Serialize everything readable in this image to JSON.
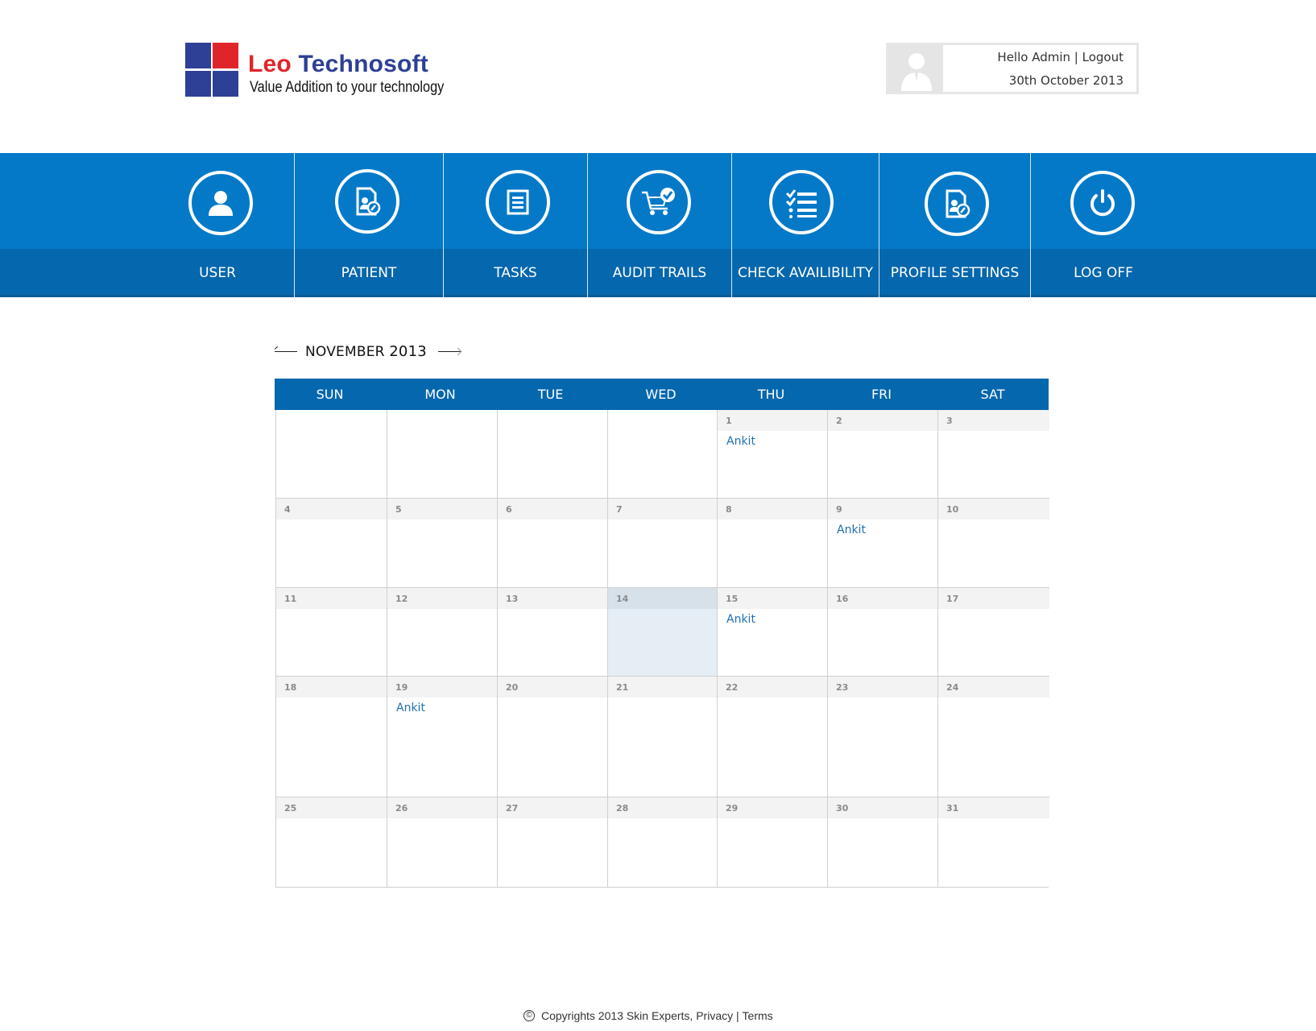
{
  "header": {
    "brand": {
      "name_part1": "Leo",
      "name_part2": "Technosoft",
      "tagline": "Value Addition to your technology"
    },
    "user": {
      "greeting": "Hello Admin",
      "separator": "|",
      "logout_label": "Logout",
      "date": "30th October 2013"
    }
  },
  "nav": {
    "items": [
      {
        "label": "USER",
        "icon": "user-icon"
      },
      {
        "label": "PATIENT",
        "icon": "patient-icon"
      },
      {
        "label": "TASKS",
        "icon": "tasks-icon"
      },
      {
        "label": "AUDIT TRAILS",
        "icon": "cart-check-icon"
      },
      {
        "label": "CHECK AVAILIBILITY",
        "icon": "checklist-icon"
      },
      {
        "label": "PROFILE SETTINGS",
        "icon": "profile-settings-icon"
      },
      {
        "label": "LOG OFF",
        "icon": "power-icon"
      }
    ]
  },
  "calendar": {
    "month": "NOVEMBER",
    "year": "2013",
    "weekdays": [
      "SUN",
      "MON",
      "TUE",
      "WED",
      "THU",
      "FRI",
      "SAT"
    ],
    "today": 14,
    "weeks": [
      [
        "",
        "",
        "",
        "",
        "1",
        "2",
        "3"
      ],
      [
        "4",
        "5",
        "6",
        "7",
        "8",
        "9",
        "10"
      ],
      [
        "11",
        "12",
        "13",
        "14",
        "15",
        "16",
        "17"
      ],
      [
        "18",
        "19",
        "20",
        "21",
        "22",
        "23",
        "24"
      ],
      [
        "25",
        "26",
        "27",
        "28",
        "29",
        "30",
        "31"
      ]
    ],
    "events": {
      "1": "Ankit",
      "9": "Ankit",
      "15": "Ankit",
      "19": "Ankit"
    }
  },
  "footer": {
    "copyright_symbol": "©",
    "text": "Copyrights 2013 Skin Experts,",
    "privacy": "Privacy",
    "separator": "|",
    "terms": "Terms"
  },
  "colors": {
    "nav_top": "#0479c8",
    "nav_bottom": "#0567ad",
    "brand_blue": "#2e3f96",
    "brand_red": "#e0252a",
    "event": "#1f6fb2"
  }
}
